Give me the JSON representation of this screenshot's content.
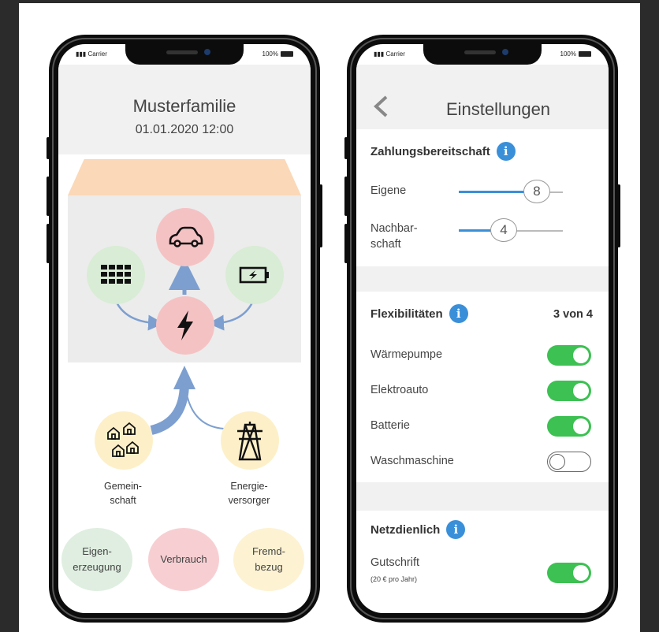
{
  "left_phone": {
    "status": {
      "carrier": "Carrier",
      "battery": "100%"
    },
    "title": "Musterfamilie",
    "datetime": "01.01.2020 12:00",
    "nodes": {
      "car": {
        "icon": "car-icon"
      },
      "solar": {
        "icon": "solar-panel-icon"
      },
      "battery": {
        "icon": "battery-charging-icon"
      },
      "center": {
        "icon": "lightning-icon"
      },
      "community": {
        "icon": "houses-icon",
        "label_1": "Gemein-",
        "label_2": "schaft"
      },
      "utility": {
        "icon": "power-pylon-icon",
        "label_1": "Energie-",
        "label_2": "versorger"
      }
    },
    "legend": {
      "own": {
        "line1": "Eigen-",
        "line2": "erzeugung"
      },
      "consumption": {
        "line1": "Verbrauch"
      },
      "external": {
        "line1": "Fremd-",
        "line2": "bezug"
      }
    }
  },
  "right_phone": {
    "status": {
      "carrier": "Carrier",
      "battery": "100%"
    },
    "title": "Einstellungen",
    "willingness": {
      "title": "Zahlungsbereitschaft",
      "own": {
        "label": "Eigene",
        "value": "8"
      },
      "neighborhood": {
        "label_1": "Nachbar-",
        "label_2": "schaft",
        "value": "4"
      }
    },
    "flex": {
      "title": "Flexibilitäten",
      "count": "3 von 4",
      "items": [
        {
          "label": "Wärmepumpe",
          "on": true
        },
        {
          "label": "Elektroauto",
          "on": true
        },
        {
          "label": "Batterie",
          "on": true
        },
        {
          "label": "Waschmaschine",
          "on": false
        }
      ]
    },
    "grid": {
      "title": "Netzdienlich",
      "credit_label": "Gutschrift",
      "credit_note": "(20 € pro Jahr)",
      "on": true
    }
  },
  "colors": {
    "accent_blue": "#3a8fd9",
    "toggle_green": "#3cc152",
    "pink": "#f5c2c4",
    "green_soft": "#d9ecd5",
    "yellow_soft": "#fdf0c8",
    "arrow_blue": "#7d9fd0"
  }
}
